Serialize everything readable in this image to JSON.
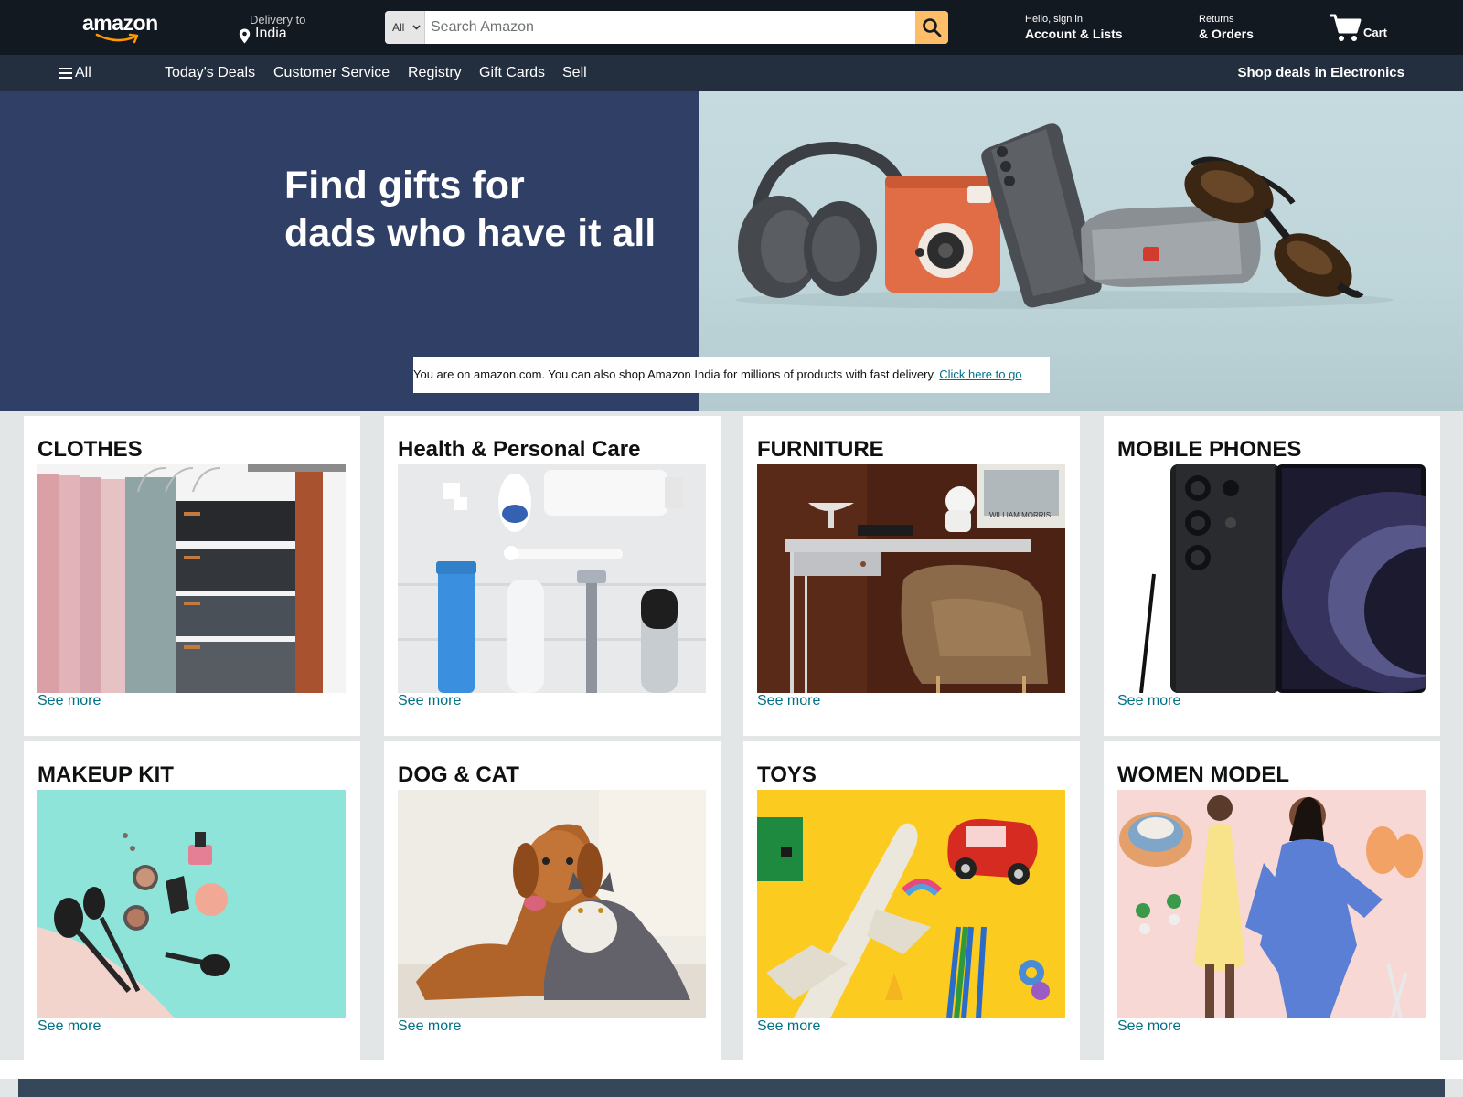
{
  "header": {
    "logo_text": "amazon",
    "deliver_line1": "Delivery to",
    "deliver_line2": "India",
    "search_category": "All",
    "search_placeholder": "Search Amazon",
    "account_line1": "Hello, sign in",
    "account_line2": "Account & Lists",
    "orders_line1": "Returns",
    "orders_line2": "& Orders",
    "cart_label": "Cart"
  },
  "subnav": {
    "all_label": "All",
    "items": [
      "Today's Deals",
      "Customer Service",
      "Registry",
      "Gift Cards",
      "Sell"
    ],
    "promo": "Shop deals in Electronics"
  },
  "hero": {
    "title_line1": "Find gifts for",
    "title_line2": "dads who have it all",
    "notice_text": "You are on amazon.com. You can also shop Amazon India for millions of products with fast delivery. ",
    "notice_link": "Click here to go"
  },
  "cards": [
    {
      "title": "CLOTHES",
      "link": "See more"
    },
    {
      "title": "Health & Personal Care",
      "link": "See more"
    },
    {
      "title": "FURNITURE",
      "link": "See more"
    },
    {
      "title": "MOBILE PHONES",
      "link": "See more"
    },
    {
      "title": "MAKEUP KIT",
      "link": "See more"
    },
    {
      "title": "DOG & CAT",
      "link": "See more"
    },
    {
      "title": "TOYS",
      "link": "See more"
    },
    {
      "title": "WOMEN MODEL",
      "link": "See more"
    }
  ],
  "furniture_art_text": "WILLIAM   MORRIS",
  "colors": {
    "nav_bg": "#131921",
    "subnav_bg": "#232f3e",
    "search_button": "#febd69",
    "hero_left": "#2f3f66",
    "link": "#007185",
    "page_bg": "#e3e6e6"
  }
}
